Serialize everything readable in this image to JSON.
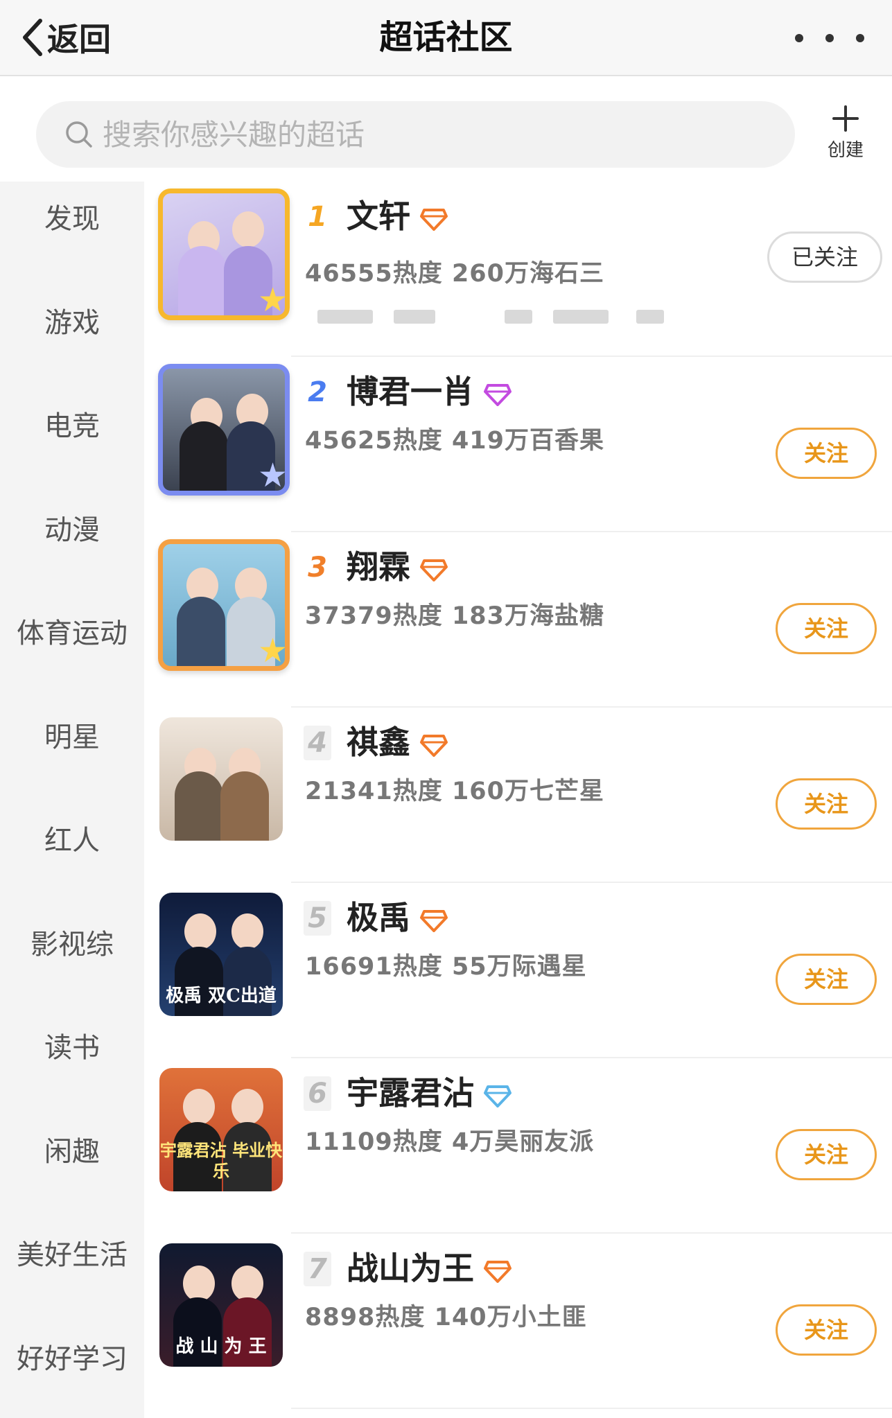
{
  "navbar": {
    "back_label": "返回",
    "title": "超话社区"
  },
  "search": {
    "placeholder": "搜索你感兴趣的超话",
    "create_label": "创建"
  },
  "sidebar": {
    "items": [
      {
        "label": "发现"
      },
      {
        "label": "游戏"
      },
      {
        "label": "电竞"
      },
      {
        "label": "动漫"
      },
      {
        "label": "体育运动"
      },
      {
        "label": "明星"
      },
      {
        "label": "红人"
      },
      {
        "label": "影视综"
      },
      {
        "label": "读书"
      },
      {
        "label": "闲趣"
      },
      {
        "label": "美好生活"
      },
      {
        "label": "好好学习"
      }
    ]
  },
  "ranking": {
    "items": [
      {
        "rank": "1",
        "name": "文轩",
        "stats": "46555热度 260万海石三",
        "button": "已关注",
        "followed": true,
        "badge_color": "#f27a2a",
        "thumb_caption": ""
      },
      {
        "rank": "2",
        "name": "博君一肖",
        "stats": "45625热度 419万百香果",
        "button": "关注",
        "followed": false,
        "badge_color": "#c34be0",
        "thumb_caption": ""
      },
      {
        "rank": "3",
        "name": "翔霖",
        "stats": "37379热度 183万海盐糖",
        "button": "关注",
        "followed": false,
        "badge_color": "#f27a2a",
        "thumb_caption": ""
      },
      {
        "rank": "4",
        "name": "祺鑫",
        "stats": "21341热度 160万七芒星",
        "button": "关注",
        "followed": false,
        "badge_color": "#f27a2a",
        "thumb_caption": ""
      },
      {
        "rank": "5",
        "name": "极禹",
        "stats": "16691热度 55万际遇星",
        "button": "关注",
        "followed": false,
        "badge_color": "#f27a2a",
        "thumb_caption": "极禹 双C出道"
      },
      {
        "rank": "6",
        "name": "宇露君沾",
        "stats": "11109热度 4万昊丽友派",
        "button": "关注",
        "followed": false,
        "badge_color": "#5ab4e8",
        "thumb_caption": "宇露君沾 毕业快乐"
      },
      {
        "rank": "7",
        "name": "战山为王",
        "stats": "8898热度 140万小土匪",
        "button": "关注",
        "followed": false,
        "badge_color": "#f27a2a",
        "thumb_caption": "战 山 为 王"
      }
    ]
  },
  "colors": {
    "accent": "#f0a53d",
    "follow_text": "#e8961a",
    "sidebar_bg": "#f4f4f4"
  }
}
